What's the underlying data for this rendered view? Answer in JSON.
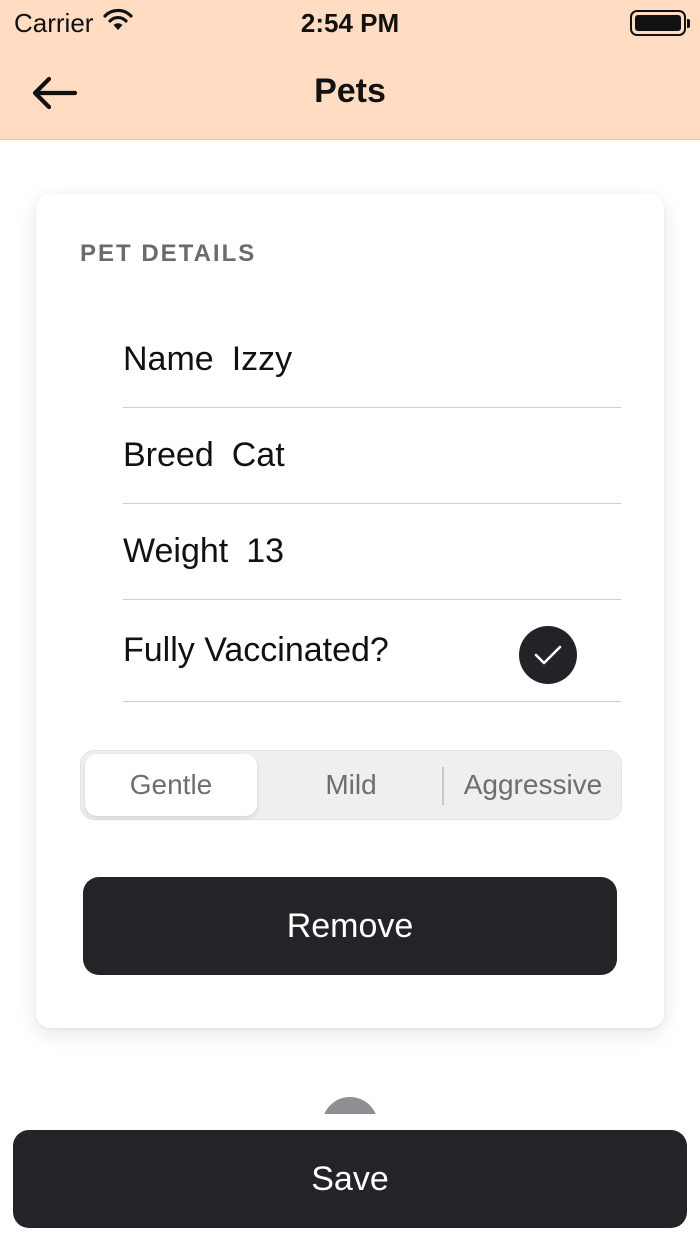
{
  "status_bar": {
    "carrier": "Carrier",
    "time": "2:54 PM",
    "icons": [
      "wifi-icon",
      "battery-icon"
    ]
  },
  "nav": {
    "title": "Pets",
    "back_icon": "arrow-left-icon"
  },
  "pet_details": {
    "header": "PET DETAILS",
    "fields": [
      {
        "label": "Name",
        "value": "Izzy"
      },
      {
        "label": "Breed",
        "value": "Cat"
      },
      {
        "label": "Weight",
        "value": "13"
      }
    ],
    "vaccinated": {
      "label": "Fully Vaccinated?",
      "checked": true,
      "icon": "checkmark-icon"
    },
    "temperament": {
      "options": [
        "Gentle",
        "Mild",
        "Aggressive"
      ],
      "selected": "Gentle"
    },
    "remove_label": "Remove"
  },
  "save_label": "Save",
  "colors": {
    "header_bg": "#ffdcc2",
    "button_bg": "#232427",
    "card_bg": "#ffffff",
    "segment_bg": "#efefef"
  }
}
